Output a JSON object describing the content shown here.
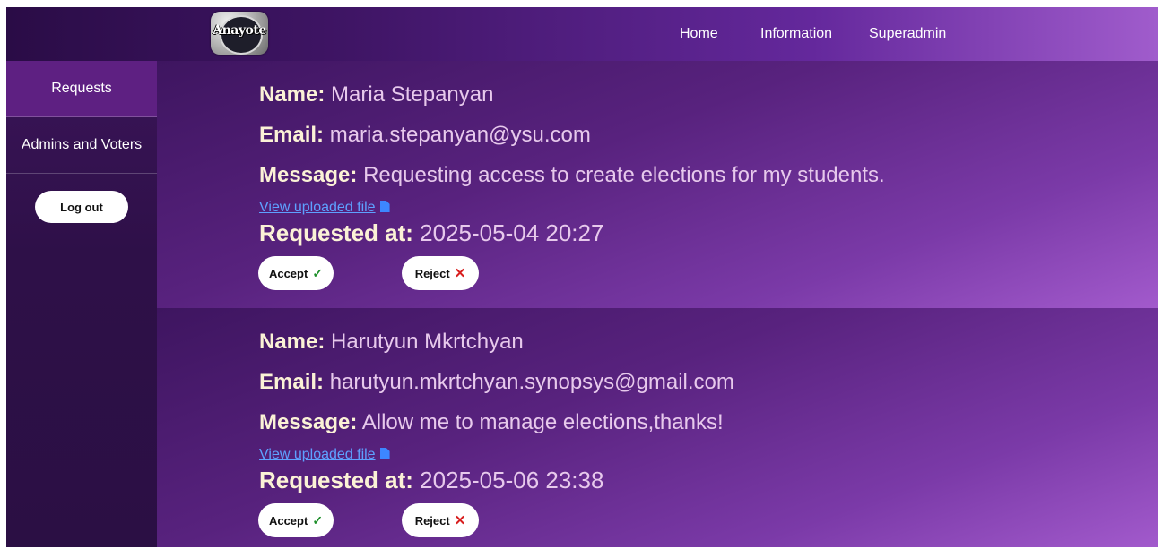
{
  "nav": {
    "logo_text": "Anayote",
    "links": [
      "Home",
      "Information",
      "Superadmin"
    ]
  },
  "sidebar": {
    "items": [
      {
        "label": "Requests",
        "active": true
      },
      {
        "label": "Admins and Voters",
        "active": false
      }
    ],
    "logout_label": "Log out"
  },
  "requests": [
    {
      "name_label": "Name:",
      "name": "Maria Stepanyan",
      "email_label": "Email:",
      "email": "maria.stepanyan@ysu.com",
      "message_label": "Message:",
      "message": "Requesting access to create elections for my students.",
      "file_link": "View uploaded file",
      "requested_label": "Requested at:",
      "requested_at": "2025-05-04 20:27",
      "accept_label": "Accept",
      "reject_label": "Reject"
    },
    {
      "name_label": "Name:",
      "name": "Harutyun Mkrtchyan",
      "email_label": "Email:",
      "email": "harutyun.mkrtchyan.synopsys@gmail.com",
      "message_label": "Message:",
      "message": "Allow me to manage elections,thanks!",
      "file_link": "View uploaded file",
      "requested_label": "Requested at:",
      "requested_at": "2025-05-06 23:38",
      "accept_label": "Accept",
      "reject_label": "Reject"
    }
  ],
  "colors": {
    "accept_icon": "#1e8f2a",
    "reject_icon": "#d81e1e",
    "link": "#5ea1ff",
    "label": "#fbf2d6",
    "value": "#e7c9ec"
  }
}
